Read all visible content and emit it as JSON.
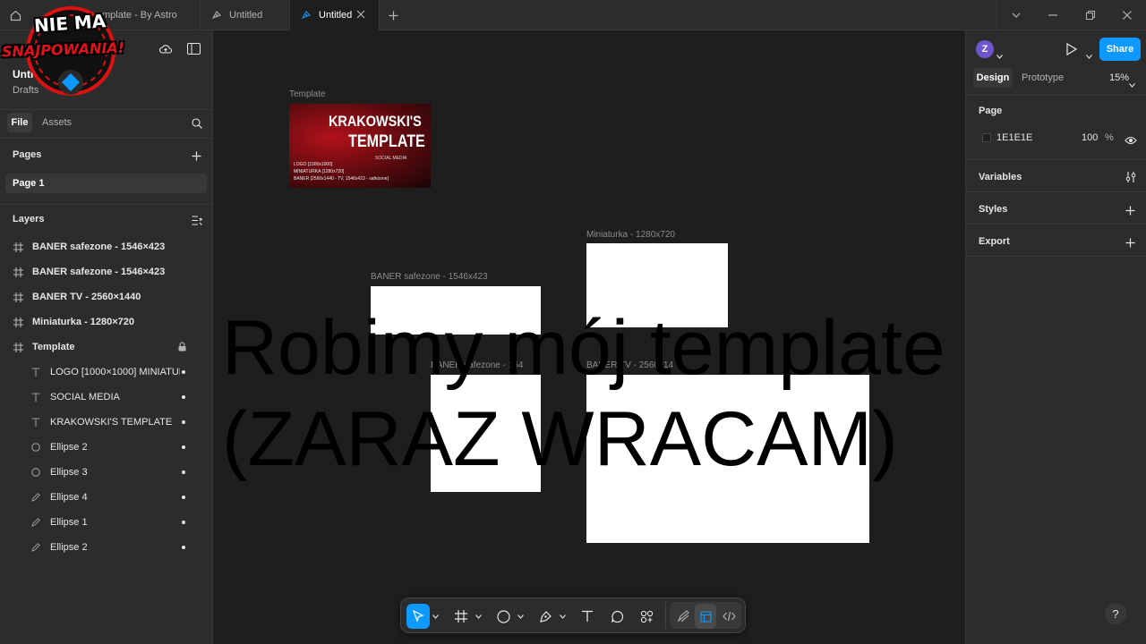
{
  "tabs": [
    {
      "label": "mplate - By Astro",
      "active": false
    },
    {
      "label": "Untitled",
      "active": false
    },
    {
      "label": "Untitled",
      "active": true
    }
  ],
  "file": {
    "name": "Unti",
    "location": "Drafts"
  },
  "left_tabs": {
    "file": "File",
    "assets": "Assets"
  },
  "pages": {
    "heading": "Pages",
    "items": [
      "Page 1"
    ]
  },
  "layers": {
    "heading": "Layers",
    "items": [
      {
        "label": "BANER safezone - 1546×423",
        "icon": "frame-icon"
      },
      {
        "label": "BANER safezone - 1546×423",
        "icon": "frame-icon"
      },
      {
        "label": "BANER TV - 2560×1440",
        "icon": "frame-icon"
      },
      {
        "label": "Miniaturka - 1280×720",
        "icon": "frame-icon"
      },
      {
        "label": "Template",
        "icon": "frame-icon"
      },
      {
        "label": "LOGO [1000×1000] MINIATURKA",
        "icon": "text-icon"
      },
      {
        "label": "SOCIAL MEDIA",
        "icon": "text-icon"
      },
      {
        "label": "KRAKOWSKI'S TEMPLATE",
        "icon": "text-icon"
      },
      {
        "label": "Ellipse 2",
        "icon": "ellipse-icon"
      },
      {
        "label": "Ellipse 3",
        "icon": "ellipse-icon"
      },
      {
        "label": "Ellipse 4",
        "icon": "pencil-icon"
      },
      {
        "label": "Ellipse 1",
        "icon": "pencil-icon"
      },
      {
        "label": "Ellipse 2",
        "icon": "pencil-icon"
      }
    ]
  },
  "right": {
    "avatar": "Z",
    "share": "Share",
    "tab_design": "Design",
    "tab_prototype": "Prototype",
    "zoom": "15%",
    "page_heading": "Page",
    "page_color": "1E1E1E",
    "page_opacity": "100",
    "percent": "%",
    "variables": "Variables",
    "styles": "Styles",
    "export": "Export"
  },
  "canvas": {
    "template_label": "Template",
    "template_title_1": "KRAKOWSKI'S",
    "template_title_2": "TEMPLATE",
    "template_sub": "SOCIAL MEDIA",
    "template_lines": [
      "LOGO [1000x1000]",
      "MINIATURKA [1280x720]",
      "BANER [2560x1440 - TV, 1546x423 - safezone]"
    ],
    "miniaturka_label": "Miniaturka - 1280x720",
    "baner_safe_label": "BANER safezone - 1546x423",
    "baner_safe2_label": "BANER safezone - 154",
    "baner_tv_label": "BANER TV - 2560x14",
    "overlay_line1": "Robimy mój template",
    "overlay_line2": "(ZARAZ WRACAM)"
  },
  "badge": {
    "line1": "NIE MA",
    "line2": "SNAJPOWANIA!"
  },
  "help": "?",
  "colors": {
    "accent": "#0d99ff",
    "panel": "#2c2c2c",
    "canvas": "#1e1e1e",
    "avatar": "#6e56cf"
  }
}
